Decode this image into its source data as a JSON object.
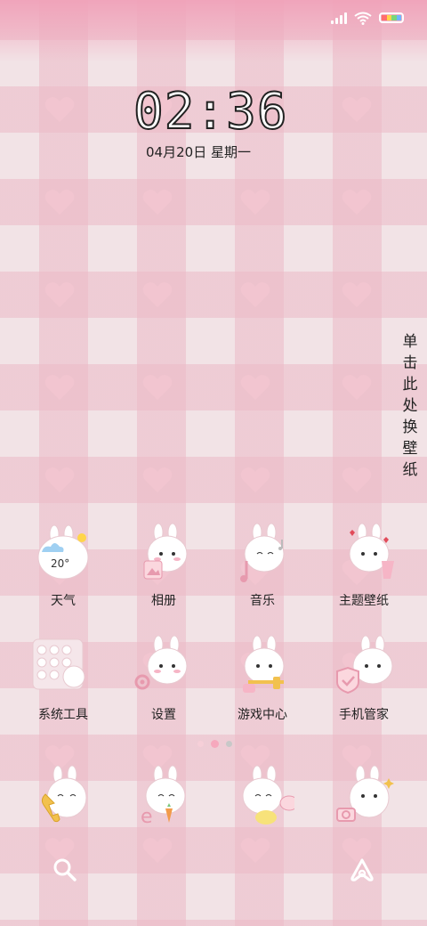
{
  "status_bar": {
    "signal_icon": "cellular-signal-icon",
    "wifi_icon": "wifi-icon",
    "battery_icon": "battery-icon",
    "battery_colors": [
      "#ff6f6f",
      "#ffd54a",
      "#7bd67b",
      "#6fb6ff"
    ]
  },
  "clock": {
    "time": "02:36",
    "date": "04月20日 星期一"
  },
  "wallpaper_switch": {
    "label": "单击此处换壁纸"
  },
  "apps_row1": [
    {
      "label": "天气",
      "icon": "weather-bunny-icon",
      "weather": "20°"
    },
    {
      "label": "相册",
      "icon": "gallery-bunny-icon"
    },
    {
      "label": "音乐",
      "icon": "music-bunny-icon"
    },
    {
      "label": "主题壁纸",
      "icon": "themes-bunny-icon"
    }
  ],
  "apps_row2": [
    {
      "label": "系统工具",
      "icon": "system-tools-folder-icon"
    },
    {
      "label": "设置",
      "icon": "settings-bunny-icon"
    },
    {
      "label": "游戏中心",
      "icon": "game-center-bunny-icon"
    },
    {
      "label": "手机管家",
      "icon": "security-bunny-icon"
    }
  ],
  "dock": [
    {
      "icon": "phone-bunny-icon"
    },
    {
      "icon": "browser-bunny-icon"
    },
    {
      "icon": "messages-bunny-icon"
    },
    {
      "icon": "camera-bunny-icon"
    }
  ],
  "page_indicator": {
    "count": 3,
    "active": 1
  },
  "bottom_bar": {
    "left_icon": "search-icon",
    "right_icon": "assistant-icon"
  },
  "colors": {
    "accent_pink": "#f4a3b8",
    "background_pink": "#f2e3e6",
    "text": "#222222"
  }
}
